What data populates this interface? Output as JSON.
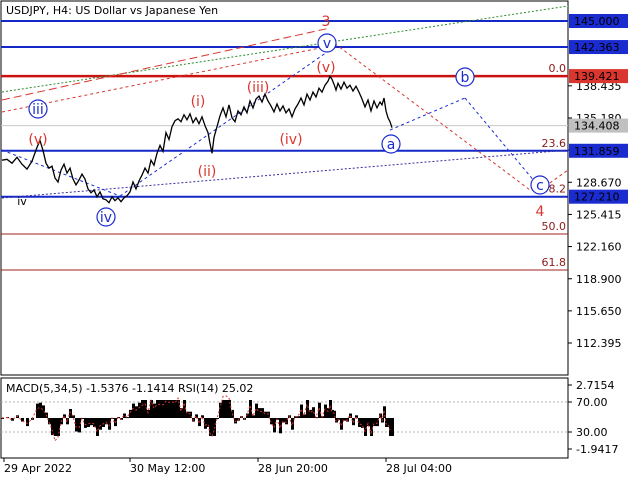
{
  "header": {
    "symbol_line": "USDJPY, H4:  US Dollar vs Japanese Yen"
  },
  "colors": {
    "price_line": "#000000",
    "blue_level": "#1428c8",
    "red_level": "#cc1111",
    "fib_line": "#a02020",
    "wave_red": "#d8362e",
    "wave_blue": "#1a2bd0",
    "green_dotted": "#2a8a2a",
    "level_label_bg_blue": "#1a2bd0",
    "level_label_bg_red": "#d8362e",
    "level_label_bg_gray": "#c0c0c0"
  },
  "chart_data": [
    {
      "type": "line",
      "title": "USDJPY, H4:  US Dollar vs Japanese Yen",
      "ylim": [
        110.5,
        147.5
      ],
      "y_ticks": [
        "138.435",
        "135.180",
        "131.925",
        "128.670",
        "125.415",
        "122.160",
        "118.900",
        "115.650",
        "112.395"
      ],
      "x_tick_labels": [
        "29 Apr 2022",
        "30 May 12:00",
        "28 Jun 20:00",
        "28 Jul 04:00"
      ],
      "price_points": [
        [
          0,
          130.9
        ],
        [
          5,
          131.0
        ],
        [
          10,
          130.6
        ],
        [
          15,
          131.2
        ],
        [
          20,
          130.5
        ],
        [
          25,
          130.0
        ],
        [
          30,
          130.8
        ],
        [
          35,
          132.2
        ],
        [
          38,
          132.9
        ],
        [
          41,
          131.9
        ],
        [
          44,
          130.6
        ],
        [
          47,
          130.1
        ],
        [
          50,
          130.3
        ],
        [
          53,
          129.1
        ],
        [
          56,
          128.7
        ],
        [
          59,
          129.9
        ],
        [
          62,
          130.5
        ],
        [
          65,
          129.6
        ],
        [
          68,
          130.1
        ],
        [
          71,
          129.0
        ],
        [
          74,
          128.4
        ],
        [
          77,
          128.9
        ],
        [
          80,
          129.5
        ],
        [
          83,
          129.0
        ],
        [
          86,
          128.0
        ],
        [
          89,
          127.6
        ],
        [
          92,
          127.9
        ],
        [
          95,
          127.2
        ],
        [
          98,
          127.7
        ],
        [
          101,
          127.0
        ],
        [
          104,
          126.9
        ],
        [
          107,
          126.6
        ],
        [
          110,
          127.2
        ],
        [
          113,
          126.8
        ],
        [
          116,
          127.1
        ],
        [
          119,
          126.7
        ],
        [
          122,
          127.1
        ],
        [
          125,
          127.3
        ],
        [
          128,
          127.7
        ],
        [
          131,
          128.7
        ],
        [
          134,
          128.0
        ],
        [
          137,
          128.8
        ],
        [
          140,
          129.4
        ],
        [
          143,
          130.1
        ],
        [
          146,
          129.6
        ],
        [
          149,
          130.9
        ],
        [
          152,
          130.4
        ],
        [
          155,
          131.6
        ],
        [
          158,
          132.4
        ],
        [
          161,
          131.8
        ],
        [
          164,
          133.7
        ],
        [
          167,
          133.0
        ],
        [
          170,
          134.3
        ],
        [
          173,
          134.9
        ],
        [
          176,
          135.1
        ],
        [
          179,
          134.8
        ],
        [
          182,
          135.5
        ],
        [
          185,
          135.0
        ],
        [
          188,
          135.6
        ],
        [
          191,
          134.7
        ],
        [
          194,
          135.2
        ],
        [
          197,
          134.6
        ],
        [
          200,
          135.3
        ],
        [
          203,
          134.4
        ],
        [
          206,
          133.7
        ],
        [
          208,
          132.6
        ],
        [
          210,
          131.6
        ],
        [
          212,
          133.2
        ],
        [
          215,
          134.3
        ],
        [
          218,
          135.4
        ],
        [
          221,
          136.2
        ],
        [
          224,
          135.3
        ],
        [
          227,
          136.5
        ],
        [
          230,
          135.2
        ],
        [
          233,
          134.8
        ],
        [
          236,
          135.9
        ],
        [
          239,
          135.5
        ],
        [
          242,
          136.3
        ],
        [
          245,
          135.7
        ],
        [
          248,
          136.9
        ],
        [
          251,
          136.2
        ],
        [
          254,
          137.1
        ],
        [
          257,
          137.4
        ],
        [
          260,
          136.8
        ],
        [
          263,
          137.6
        ],
        [
          266,
          136.9
        ],
        [
          269,
          136.4
        ],
        [
          272,
          135.8
        ],
        [
          275,
          136.6
        ],
        [
          278,
          135.9
        ],
        [
          281,
          136.4
        ],
        [
          284,
          135.7
        ],
        [
          287,
          136.1
        ],
        [
          290,
          135.3
        ],
        [
          293,
          136.1
        ],
        [
          296,
          136.6
        ],
        [
          299,
          137.2
        ],
        [
          302,
          136.5
        ],
        [
          305,
          137.6
        ],
        [
          308,
          137.0
        ],
        [
          311,
          137.8
        ],
        [
          314,
          137.3
        ],
        [
          317,
          138.2
        ],
        [
          320,
          137.8
        ],
        [
          323,
          138.5
        ],
        [
          326,
          138.9
        ],
        [
          328,
          139.4
        ],
        [
          330,
          139.1
        ],
        [
          332,
          138.6
        ],
        [
          334,
          138.0
        ],
        [
          336,
          138.7
        ],
        [
          339,
          138.1
        ],
        [
          342,
          138.8
        ],
        [
          345,
          138.2
        ],
        [
          348,
          138.5
        ],
        [
          351,
          137.9
        ],
        [
          354,
          138.4
        ],
        [
          357,
          137.8
        ],
        [
          360,
          137.1
        ],
        [
          363,
          136.3
        ],
        [
          366,
          137.0
        ],
        [
          369,
          135.9
        ],
        [
          372,
          136.9
        ],
        [
          375,
          136.2
        ],
        [
          378,
          136.8
        ],
        [
          380,
          136.5
        ],
        [
          382,
          137.2
        ],
        [
          384,
          135.9
        ],
        [
          386,
          135.2
        ],
        [
          388,
          134.8
        ],
        [
          390,
          134.2
        ]
      ],
      "horizontal_levels": [
        {
          "price": "145.000",
          "style": "blue"
        },
        {
          "price": "142.363",
          "style": "blue"
        },
        {
          "price": "139.421",
          "style": "red",
          "fib": "0.0"
        },
        {
          "price": "134.408",
          "style": "gray"
        },
        {
          "price": "131.859",
          "style": "blue",
          "fib": "23.6"
        },
        {
          "price": "127.210",
          "style": "blue",
          "fib": "38.2"
        },
        {
          "fib": "50.0",
          "style": "thin"
        },
        {
          "fib": "61.8",
          "style": "thin"
        }
      ],
      "wave_labels": {
        "red": [
          "3",
          "(i)",
          "(ii)",
          "(iii)",
          "(iv)",
          "(v)",
          "(v)",
          "4"
        ],
        "blue": [
          "iii",
          "iv",
          "v",
          "a",
          "b",
          "c"
        ],
        "gray": [
          "iv"
        ]
      }
    },
    {
      "type": "line",
      "title": "MACD(5,34,5) -1.5376 -1.1414 RSI(14) 25.02",
      "y_ticks": [
        "2.7154",
        "70.00",
        "30.00",
        "-1.9417"
      ],
      "x_tick_labels": [
        "29 Apr 2022",
        "30 May 12:00",
        "28 Jun 20:00",
        "28 Jul 04:00"
      ]
    }
  ],
  "indicator": {
    "title": "MACD(5,34,5) -1.5376 -1.1414 RSI(14) 25.02"
  }
}
